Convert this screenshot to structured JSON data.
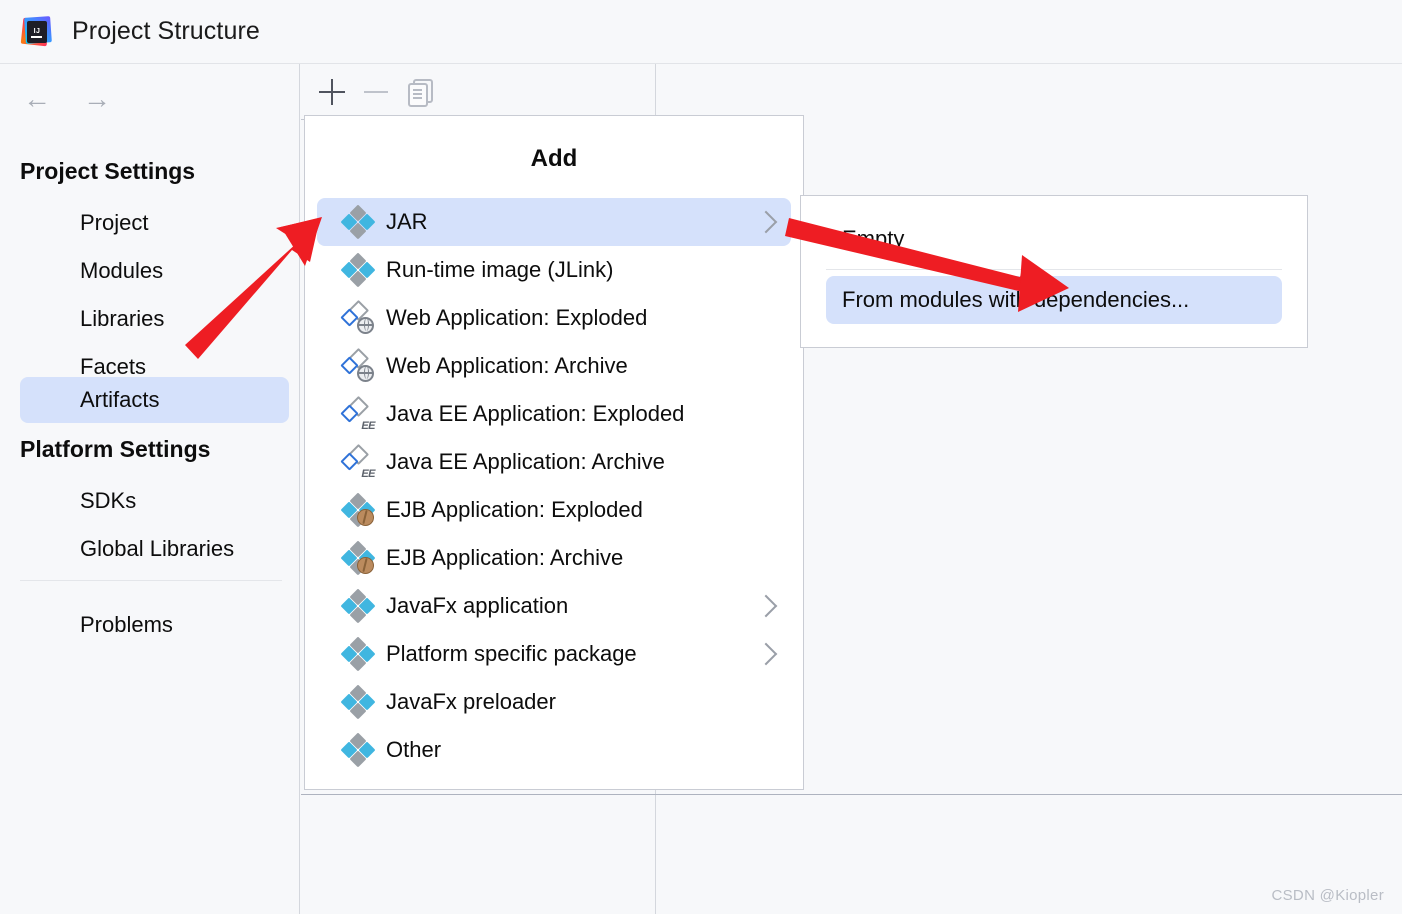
{
  "window": {
    "title": "Project Structure",
    "logo_icon": "intellij-idea-logo",
    "logo_text": "IJ"
  },
  "navigation": {
    "back_icon": "arrow-left-icon",
    "back_glyph": "←",
    "forward_icon": "arrow-right-icon",
    "forward_glyph": "→"
  },
  "sidebar": {
    "groups": [
      {
        "title": "Project Settings",
        "items": [
          {
            "label": "Project",
            "selected": false
          },
          {
            "label": "Modules",
            "selected": false
          },
          {
            "label": "Libraries",
            "selected": false
          },
          {
            "label": "Facets",
            "selected": false
          },
          {
            "label": "Artifacts",
            "selected": true
          }
        ]
      },
      {
        "title": "Platform Settings",
        "items": [
          {
            "label": "SDKs",
            "selected": false
          },
          {
            "label": "Global Libraries",
            "selected": false
          }
        ]
      }
    ],
    "problems": {
      "label": "Problems",
      "selected": false
    }
  },
  "toolbar": {
    "add_label": "+",
    "add_icon": "plus-icon",
    "remove_label": "−",
    "remove_icon": "minus-icon",
    "remove_disabled": true,
    "copy_icon": "copy-icon"
  },
  "add_popup": {
    "title": "Add",
    "items": [
      {
        "label": "JAR",
        "icon": "artifact-diamonds-icon",
        "selected": true,
        "submenu": true
      },
      {
        "label": "Run-time image (JLink)",
        "icon": "artifact-diamonds-icon",
        "selected": false,
        "submenu": false
      },
      {
        "label": "Web Application: Exploded",
        "icon": "web-application-globe-icon",
        "selected": false,
        "submenu": false
      },
      {
        "label": "Web Application: Archive",
        "icon": "web-application-globe-icon",
        "selected": false,
        "submenu": false
      },
      {
        "label": "Java EE Application: Exploded",
        "icon": "java-ee-application-icon",
        "selected": false,
        "submenu": false
      },
      {
        "label": "Java EE Application: Archive",
        "icon": "java-ee-application-icon",
        "selected": false,
        "submenu": false
      },
      {
        "label": "EJB Application: Exploded",
        "icon": "ejb-application-bean-icon",
        "selected": false,
        "submenu": false
      },
      {
        "label": "EJB Application: Archive",
        "icon": "ejb-application-bean-icon",
        "selected": false,
        "submenu": false
      },
      {
        "label": "JavaFx application",
        "icon": "artifact-diamonds-icon",
        "selected": false,
        "submenu": true
      },
      {
        "label": "Platform specific package",
        "icon": "artifact-diamonds-icon",
        "selected": false,
        "submenu": true
      },
      {
        "label": "JavaFx preloader",
        "icon": "artifact-diamonds-icon",
        "selected": false,
        "submenu": false
      },
      {
        "label": "Other",
        "icon": "artifact-diamonds-icon",
        "selected": false,
        "submenu": false
      }
    ]
  },
  "jar_submenu": {
    "items": [
      {
        "label": "Empty",
        "selected": false
      },
      {
        "label": "From modules with dependencies...",
        "selected": true
      }
    ]
  },
  "annotations": {
    "arrow_color": "#ee1d23",
    "arrow_1_target": "JAR",
    "arrow_2_target": "From modules with dependencies..."
  },
  "colors": {
    "selection": "#d5e1fb",
    "background": "#f7f8fa",
    "popup_background": "#ffffff",
    "border": "#c9ccd4",
    "icon_cyan": "#40b6e0",
    "icon_gray": "#9aa0a6"
  },
  "watermark": {
    "text": "CSDN @Kiopler"
  }
}
